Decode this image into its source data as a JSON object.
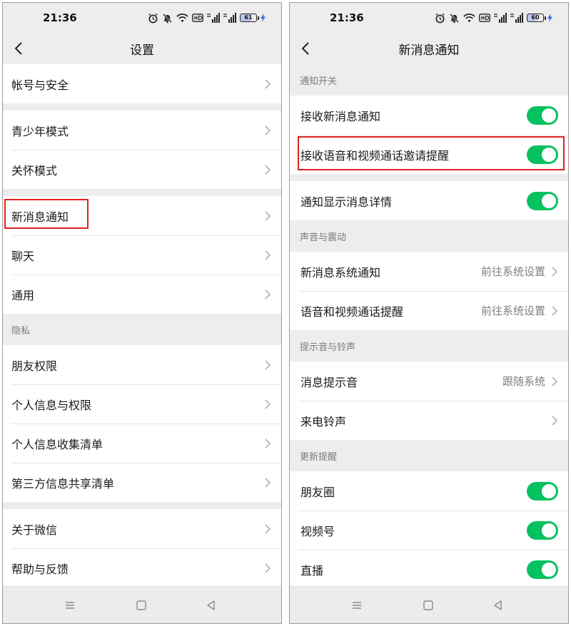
{
  "left": {
    "status": {
      "time": "21:36",
      "battery": "61"
    },
    "nav": {
      "title": "设置"
    },
    "groups": [
      {
        "header": "",
        "items": [
          "帐号与安全"
        ]
      },
      {
        "header": "",
        "items": [
          "青少年模式",
          "关怀模式"
        ]
      },
      {
        "header": "",
        "items": [
          "新消息通知",
          "聊天",
          "通用"
        ]
      },
      {
        "header": "隐私",
        "items": [
          "朋友权限",
          "个人信息与权限",
          "个人信息收集清单",
          "第三方信息共享清单"
        ]
      },
      {
        "header": "",
        "items": [
          "关于微信",
          "帮助与反馈"
        ]
      }
    ]
  },
  "right": {
    "status": {
      "time": "21:36",
      "battery": "60"
    },
    "nav": {
      "title": "新消息通知"
    },
    "sections": [
      {
        "header": "通知开关",
        "items": [
          {
            "label": "接收新消息通知",
            "toggle": true
          },
          {
            "label": "接收语音和视频通话邀请提醒",
            "toggle": true
          }
        ]
      },
      {
        "header": "",
        "items": [
          {
            "label": "通知显示消息详情",
            "toggle": true
          }
        ]
      },
      {
        "header": "声音与震动",
        "items": [
          {
            "label": "新消息系统通知",
            "value": "前往系统设置"
          },
          {
            "label": "语音和视频通话提醒",
            "value": "前往系统设置"
          }
        ]
      },
      {
        "header": "提示音与铃声",
        "items": [
          {
            "label": "消息提示音",
            "value": "跟随系统"
          },
          {
            "label": "来电铃声",
            "value": ""
          }
        ]
      },
      {
        "header": "更新提醒",
        "items": [
          {
            "label": "朋友圈",
            "toggle": true
          },
          {
            "label": "视频号",
            "toggle": true
          },
          {
            "label": "直播",
            "toggle": true
          }
        ]
      }
    ]
  },
  "colors": {
    "accent_green": "#07c160",
    "highlight_red": "#e02020",
    "background": "#ededed"
  },
  "icons": [
    "back-icon",
    "chevron-right-icon",
    "alarm-icon",
    "mute-icon",
    "wifi-icon",
    "hd-icon",
    "signal-icon",
    "battery-icon",
    "charging-icon",
    "menu-icon",
    "home-icon",
    "back-triangle-icon"
  ]
}
